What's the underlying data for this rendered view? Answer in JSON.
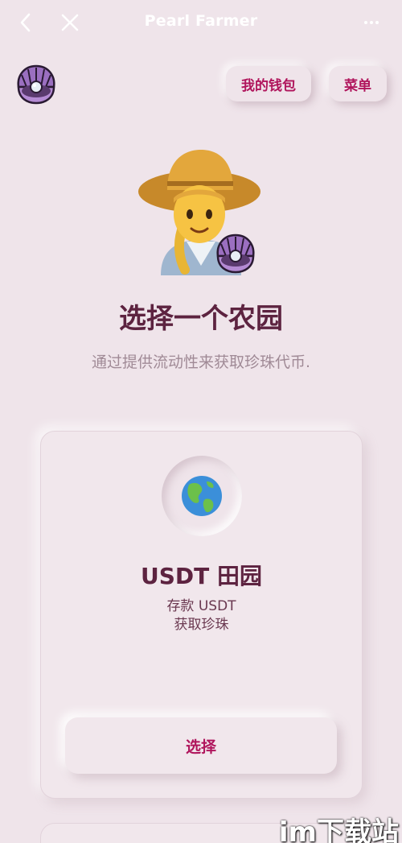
{
  "nav": {
    "title": "Pearl Farmer",
    "back_icon": "chevron-left-icon",
    "close_icon": "close-icon",
    "more_icon": "more-horizontal-icon"
  },
  "header": {
    "logo_icon": "oyster-pearl-icon",
    "wallet_label": "我的钱包",
    "menu_label": "菜单"
  },
  "hero": {
    "illustration": "farmer-woman-with-oyster-icon",
    "title": "选择一个农园",
    "subtitle": "通过提供流动性来获取珍珠代币."
  },
  "farms": [
    {
      "icon": "globe-americas-icon",
      "name": "USDT 田园",
      "desc_line1": "存款 USDT",
      "desc_line2": "获取珍珠",
      "select_label": "选择"
    }
  ],
  "watermark": "im下载站",
  "colors": {
    "background": "#efe4ea",
    "accent": "#b0155c",
    "title": "#5d2340",
    "subtitle": "#a08a96"
  }
}
